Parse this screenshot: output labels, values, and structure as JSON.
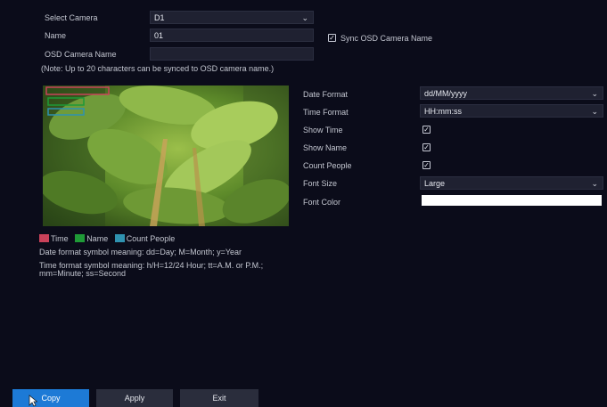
{
  "top": {
    "select_camera_label": "Select Camera",
    "select_camera_value": "D1",
    "name_label": "Name",
    "name_value": "01",
    "sync_label": "Sync OSD Camera Name",
    "osd_name_label": "OSD Camera Name",
    "osd_name_value": "",
    "note": "(Note: Up to 20 characters can be synced to OSD camera name.)"
  },
  "legend": {
    "time": "Time",
    "name": "Name",
    "count": "Count People",
    "colors": {
      "time": "#c9425a",
      "name": "#1f9a37",
      "count": "#2f92b0"
    }
  },
  "hints": {
    "date": "Date format symbol meaning: dd=Day; M=Month; y=Year",
    "time_1": "Time format symbol meaning: h/H=12/24 Hour; tt=A.M. or P.M.;",
    "time_2": "mm=Minute; ss=Second"
  },
  "settings": {
    "date_format_label": "Date Format",
    "date_format_value": "dd/MM/yyyy",
    "time_format_label": "Time Format",
    "time_format_value": "HH:mm:ss",
    "show_time_label": "Show Time",
    "show_time_checked": true,
    "show_name_label": "Show Name",
    "show_name_checked": true,
    "count_people_label": "Count People",
    "count_people_checked": true,
    "font_size_label": "Font Size",
    "font_size_value": "Large",
    "font_color_label": "Font Color",
    "font_color_value": "#ffffff"
  },
  "buttons": {
    "copy": "Copy",
    "apply": "Apply",
    "exit": "Exit"
  },
  "colors": {
    "accent": "#1d7ad6",
    "background": "#0b0c1a"
  }
}
